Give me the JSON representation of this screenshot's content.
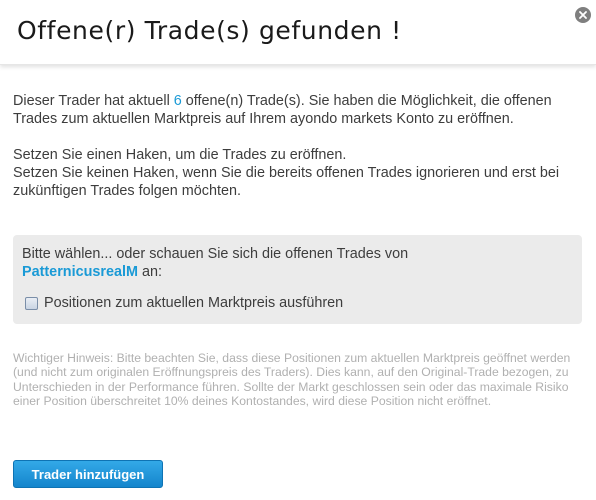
{
  "dialog": {
    "title": "Offene(r) Trade(s) gefunden !",
    "close_icon": "close-icon"
  },
  "intro": {
    "p1_before": "Dieser Trader hat aktuell ",
    "open_count": "6",
    "p1_after": " offene(n) Trade(s). Sie haben die Möglichkeit, die offenen Trades zum aktuellen Marktpreis auf Ihrem ayondo markets Konto zu eröffnen.",
    "p2_line1": "Setzen Sie einen Haken, um die Trades zu eröffnen.",
    "p2_line2": "Setzen Sie keinen Haken, wenn Sie die bereits offenen Trades ignorieren und erst bei zukünftigen Trades folgen möchten."
  },
  "choice": {
    "prompt_before": "Bitte wählen... oder schauen Sie sich die offenen Trades von ",
    "trader_name": "PatternicusrealM",
    "prompt_after": " an:",
    "checkbox_label": "Positionen zum aktuellen Marktpreis ausführen",
    "checked": false
  },
  "notice": "Wichtiger Hinweis: Bitte beachten Sie, dass diese Positionen zum aktuellen Marktpreis geöffnet werden (und nicht zum originalen Eröffnungspreis des Traders). Dies kann, auf den Original-Trade bezogen, zu Unterschieden in der Performance führen. Sollte der Markt geschlossen sein oder das maximale Risiko einer Position überschreitet 10% deines Kontostandes, wird diese Position nicht eröffnet.",
  "actions": {
    "add_trader_label": "Trader hinzufügen"
  },
  "colors": {
    "accent": "#1a9ad6",
    "button": "#1b8fd4",
    "panel": "#ebebeb",
    "notice_text": "#b0b0b0"
  }
}
